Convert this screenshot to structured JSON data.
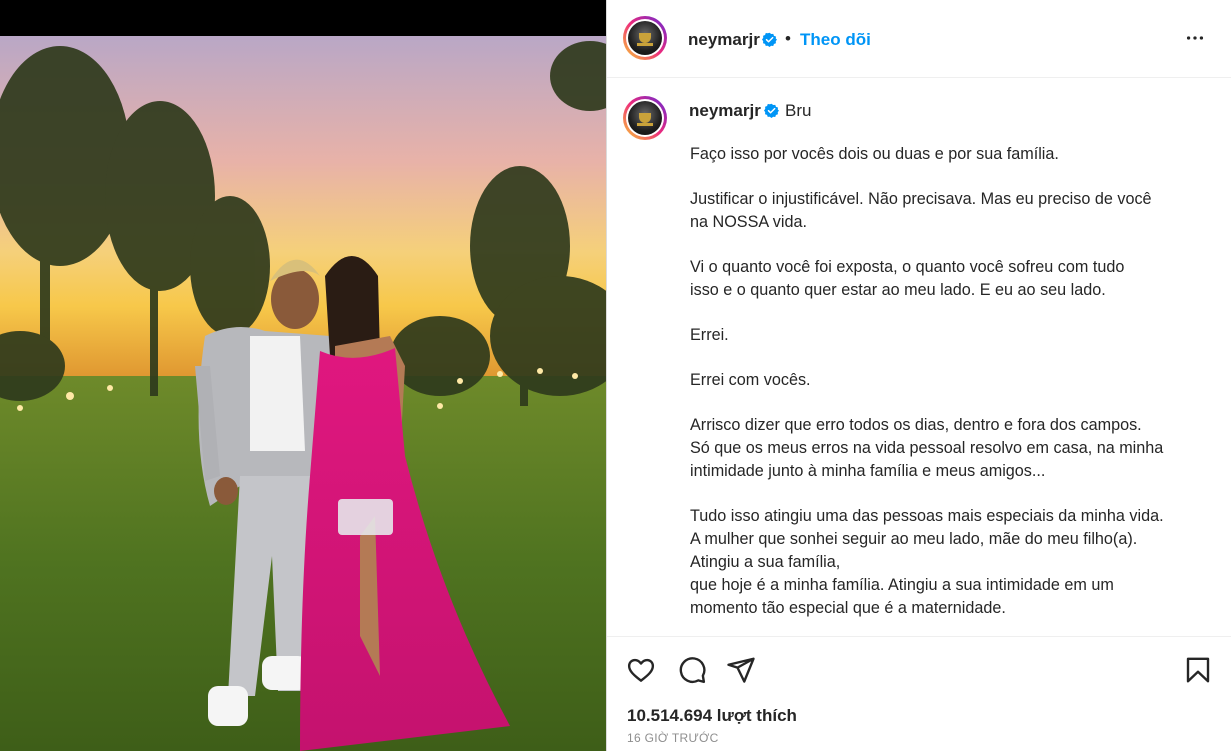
{
  "post": {
    "author": {
      "username": "neymarjr",
      "verified": true,
      "avatar": "avatar-trophy"
    },
    "follow_label": "Theo dõi",
    "separator": "•",
    "more_icon": "more-horizontal-icon",
    "caption": {
      "mention": "Bru",
      "paragraphs": [
        "Faço isso por vocês dois ou duas e por sua família.",
        "Justificar o injustificável. Não precisava. Mas eu preciso de você\nna NOSSA vida.",
        "Vi o quanto você foi exposta, o quanto você sofreu com tudo\nisso e o quanto quer estar ao meu lado. E eu ao seu lado.",
        "Errei.",
        "Errei com vocês.",
        "Arrisco dizer que erro todos os dias, dentro e fora dos campos.\nSó que os meus erros na vida pessoal resolvo em casa, na minha\nintimidade junto à minha família e meus amigos...",
        "Tudo isso atingiu uma das pessoas mais especiais da minha vida.\nA mulher que sonhei seguir ao meu lado, mãe do meu filho(a).\nAtingiu a sua família,\nque hoje é a minha família. Atingiu a sua intimidade em um\nmomento tão especial que é a maternidade."
      ]
    },
    "actions": {
      "like": "heart-icon",
      "comment": "comment-icon",
      "share": "send-icon",
      "save": "bookmark-icon"
    },
    "likes_text": "10.514.694 lượt thích",
    "timestamp": "16 GIỜ TRƯỚC"
  },
  "colors": {
    "accent": "#0095f6",
    "text": "#262626",
    "muted": "#8e8e8e",
    "verified": "#0095f6",
    "dress": "#e0177f"
  }
}
